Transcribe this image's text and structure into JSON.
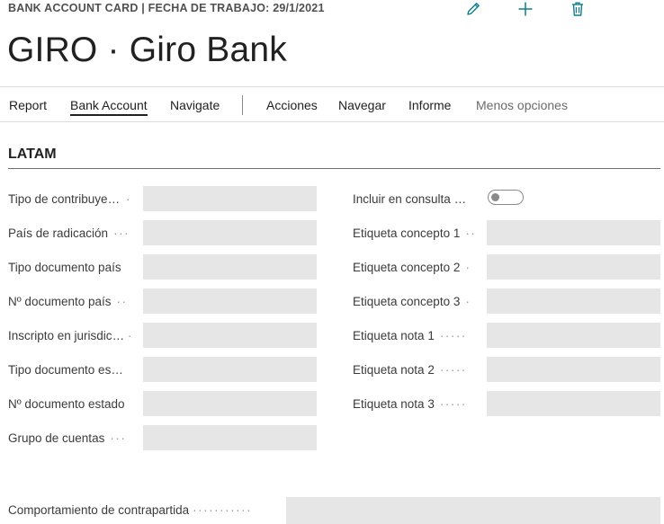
{
  "header": {
    "breadcrumb": "BANK ACCOUNT CARD | FECHA DE TRABAJO: 29/1/2021",
    "title": "GIRO · Giro Bank",
    "icons": [
      "edit-pencil-icon",
      "add-plus-icon",
      "delete-trash-icon"
    ],
    "accent_color": "#0d7e8a"
  },
  "menu": {
    "items": [
      {
        "label": "Report"
      },
      {
        "label": "Bank Account"
      },
      {
        "label": "Navigate"
      },
      {
        "label": "Acciones"
      },
      {
        "label": "Navegar"
      },
      {
        "label": "Informe"
      },
      {
        "label": "Menos opciones"
      }
    ]
  },
  "section": {
    "title": "LATAM"
  },
  "left_fields": [
    {
      "label": "Tipo de contribuyente",
      "value": ""
    },
    {
      "label": "País de radicación",
      "value": ""
    },
    {
      "label": "Tipo documento país",
      "value": ""
    },
    {
      "label": "Nº documento país",
      "value": ""
    },
    {
      "label": "Inscripto en jurisdicción",
      "value": ""
    },
    {
      "label": "Tipo documento estado",
      "value": ""
    },
    {
      "label": "Nº documento estado",
      "value": ""
    },
    {
      "label": "Grupo de cuentas",
      "value": ""
    }
  ],
  "right_fields": [
    {
      "label": "Incluir en consulta",
      "value": false
    },
    {
      "label": "Etiqueta concepto 1",
      "value": ""
    },
    {
      "label": "Etiqueta concepto 2",
      "value": ""
    },
    {
      "label": "Etiqueta concepto 3",
      "value": ""
    },
    {
      "label": "Etiqueta nota 1",
      "value": ""
    },
    {
      "label": "Etiqueta nota 2",
      "value": ""
    },
    {
      "label": "Etiqueta nota 3",
      "value": ""
    }
  ],
  "bottom_field": {
    "label": "Comportamiento de contrapartida",
    "value": ""
  }
}
